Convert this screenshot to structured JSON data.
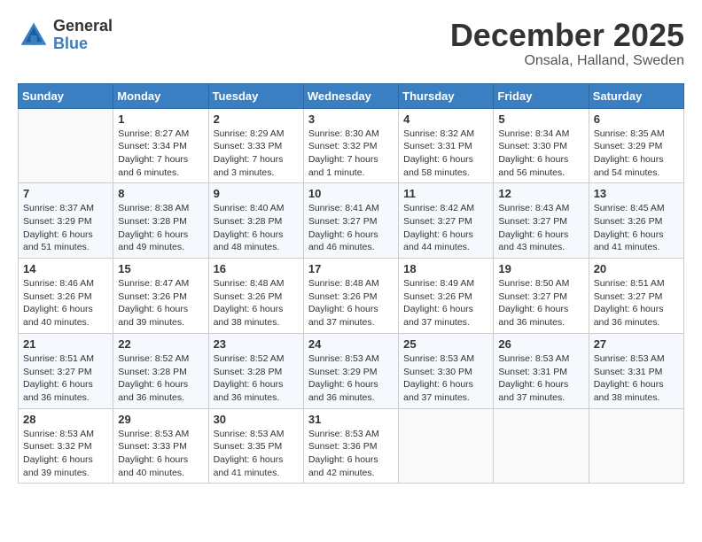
{
  "logo": {
    "line1": "General",
    "line2": "Blue"
  },
  "title": "December 2025",
  "subtitle": "Onsala, Halland, Sweden",
  "days_of_week": [
    "Sunday",
    "Monday",
    "Tuesday",
    "Wednesday",
    "Thursday",
    "Friday",
    "Saturday"
  ],
  "weeks": [
    [
      {
        "day": "",
        "info": ""
      },
      {
        "day": "1",
        "info": "Sunrise: 8:27 AM\nSunset: 3:34 PM\nDaylight: 7 hours\nand 6 minutes."
      },
      {
        "day": "2",
        "info": "Sunrise: 8:29 AM\nSunset: 3:33 PM\nDaylight: 7 hours\nand 3 minutes."
      },
      {
        "day": "3",
        "info": "Sunrise: 8:30 AM\nSunset: 3:32 PM\nDaylight: 7 hours\nand 1 minute."
      },
      {
        "day": "4",
        "info": "Sunrise: 8:32 AM\nSunset: 3:31 PM\nDaylight: 6 hours\nand 58 minutes."
      },
      {
        "day": "5",
        "info": "Sunrise: 8:34 AM\nSunset: 3:30 PM\nDaylight: 6 hours\nand 56 minutes."
      },
      {
        "day": "6",
        "info": "Sunrise: 8:35 AM\nSunset: 3:29 PM\nDaylight: 6 hours\nand 54 minutes."
      }
    ],
    [
      {
        "day": "7",
        "info": "Sunrise: 8:37 AM\nSunset: 3:29 PM\nDaylight: 6 hours\nand 51 minutes."
      },
      {
        "day": "8",
        "info": "Sunrise: 8:38 AM\nSunset: 3:28 PM\nDaylight: 6 hours\nand 49 minutes."
      },
      {
        "day": "9",
        "info": "Sunrise: 8:40 AM\nSunset: 3:28 PM\nDaylight: 6 hours\nand 48 minutes."
      },
      {
        "day": "10",
        "info": "Sunrise: 8:41 AM\nSunset: 3:27 PM\nDaylight: 6 hours\nand 46 minutes."
      },
      {
        "day": "11",
        "info": "Sunrise: 8:42 AM\nSunset: 3:27 PM\nDaylight: 6 hours\nand 44 minutes."
      },
      {
        "day": "12",
        "info": "Sunrise: 8:43 AM\nSunset: 3:27 PM\nDaylight: 6 hours\nand 43 minutes."
      },
      {
        "day": "13",
        "info": "Sunrise: 8:45 AM\nSunset: 3:26 PM\nDaylight: 6 hours\nand 41 minutes."
      }
    ],
    [
      {
        "day": "14",
        "info": "Sunrise: 8:46 AM\nSunset: 3:26 PM\nDaylight: 6 hours\nand 40 minutes."
      },
      {
        "day": "15",
        "info": "Sunrise: 8:47 AM\nSunset: 3:26 PM\nDaylight: 6 hours\nand 39 minutes."
      },
      {
        "day": "16",
        "info": "Sunrise: 8:48 AM\nSunset: 3:26 PM\nDaylight: 6 hours\nand 38 minutes."
      },
      {
        "day": "17",
        "info": "Sunrise: 8:48 AM\nSunset: 3:26 PM\nDaylight: 6 hours\nand 37 minutes."
      },
      {
        "day": "18",
        "info": "Sunrise: 8:49 AM\nSunset: 3:26 PM\nDaylight: 6 hours\nand 37 minutes."
      },
      {
        "day": "19",
        "info": "Sunrise: 8:50 AM\nSunset: 3:27 PM\nDaylight: 6 hours\nand 36 minutes."
      },
      {
        "day": "20",
        "info": "Sunrise: 8:51 AM\nSunset: 3:27 PM\nDaylight: 6 hours\nand 36 minutes."
      }
    ],
    [
      {
        "day": "21",
        "info": "Sunrise: 8:51 AM\nSunset: 3:27 PM\nDaylight: 6 hours\nand 36 minutes."
      },
      {
        "day": "22",
        "info": "Sunrise: 8:52 AM\nSunset: 3:28 PM\nDaylight: 6 hours\nand 36 minutes."
      },
      {
        "day": "23",
        "info": "Sunrise: 8:52 AM\nSunset: 3:28 PM\nDaylight: 6 hours\nand 36 minutes."
      },
      {
        "day": "24",
        "info": "Sunrise: 8:53 AM\nSunset: 3:29 PM\nDaylight: 6 hours\nand 36 minutes."
      },
      {
        "day": "25",
        "info": "Sunrise: 8:53 AM\nSunset: 3:30 PM\nDaylight: 6 hours\nand 37 minutes."
      },
      {
        "day": "26",
        "info": "Sunrise: 8:53 AM\nSunset: 3:31 PM\nDaylight: 6 hours\nand 37 minutes."
      },
      {
        "day": "27",
        "info": "Sunrise: 8:53 AM\nSunset: 3:31 PM\nDaylight: 6 hours\nand 38 minutes."
      }
    ],
    [
      {
        "day": "28",
        "info": "Sunrise: 8:53 AM\nSunset: 3:32 PM\nDaylight: 6 hours\nand 39 minutes."
      },
      {
        "day": "29",
        "info": "Sunrise: 8:53 AM\nSunset: 3:33 PM\nDaylight: 6 hours\nand 40 minutes."
      },
      {
        "day": "30",
        "info": "Sunrise: 8:53 AM\nSunset: 3:35 PM\nDaylight: 6 hours\nand 41 minutes."
      },
      {
        "day": "31",
        "info": "Sunrise: 8:53 AM\nSunset: 3:36 PM\nDaylight: 6 hours\nand 42 minutes."
      },
      {
        "day": "",
        "info": ""
      },
      {
        "day": "",
        "info": ""
      },
      {
        "day": "",
        "info": ""
      }
    ]
  ]
}
